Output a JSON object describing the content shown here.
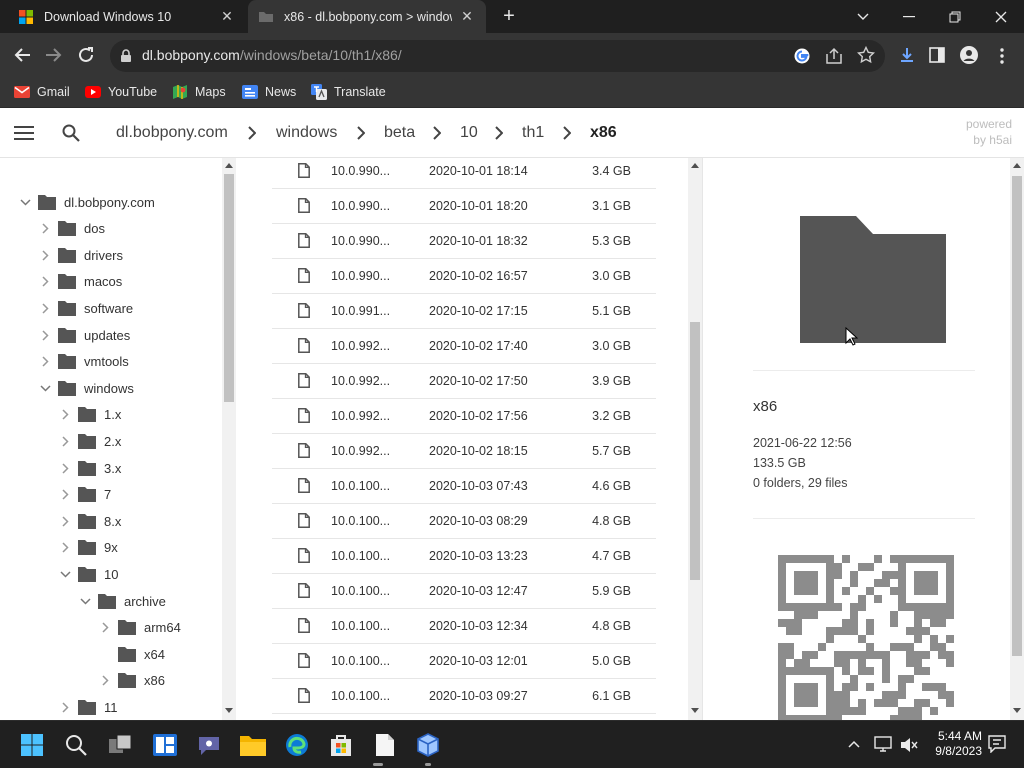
{
  "tabs": [
    {
      "title": "Download Windows 10",
      "active": false
    },
    {
      "title": "x86 - dl.bobpony.com > windows",
      "active": true
    }
  ],
  "toolbar": {
    "url_host": "dl.bobpony.com",
    "url_path": "/windows/beta/10/th1/x86/"
  },
  "bookmarks": [
    {
      "label": "Gmail",
      "icon": "gmail-icon"
    },
    {
      "label": "YouTube",
      "icon": "youtube-icon"
    },
    {
      "label": "Maps",
      "icon": "maps-icon"
    },
    {
      "label": "News",
      "icon": "news-icon"
    },
    {
      "label": "Translate",
      "icon": "translate-icon"
    }
  ],
  "breadcrumb": [
    "dl.bobpony.com",
    "windows",
    "beta",
    "10",
    "th1",
    "x86"
  ],
  "powered": {
    "line1": "powered",
    "line2": "by h5ai"
  },
  "tree": [
    {
      "label": "dl.bobpony.com",
      "depth": 0,
      "expanded": true,
      "chevron": true
    },
    {
      "label": "dos",
      "depth": 1,
      "expanded": false,
      "chevron": true
    },
    {
      "label": "drivers",
      "depth": 1,
      "expanded": false,
      "chevron": true
    },
    {
      "label": "macos",
      "depth": 1,
      "expanded": false,
      "chevron": true
    },
    {
      "label": "software",
      "depth": 1,
      "expanded": false,
      "chevron": true
    },
    {
      "label": "updates",
      "depth": 1,
      "expanded": false,
      "chevron": true
    },
    {
      "label": "vmtools",
      "depth": 1,
      "expanded": false,
      "chevron": true
    },
    {
      "label": "windows",
      "depth": 1,
      "expanded": true,
      "chevron": true
    },
    {
      "label": "1.x",
      "depth": 2,
      "expanded": false,
      "chevron": true
    },
    {
      "label": "2.x",
      "depth": 2,
      "expanded": false,
      "chevron": true
    },
    {
      "label": "3.x",
      "depth": 2,
      "expanded": false,
      "chevron": true
    },
    {
      "label": "7",
      "depth": 2,
      "expanded": false,
      "chevron": true
    },
    {
      "label": "8.x",
      "depth": 2,
      "expanded": false,
      "chevron": true
    },
    {
      "label": "9x",
      "depth": 2,
      "expanded": false,
      "chevron": true
    },
    {
      "label": "10",
      "depth": 2,
      "expanded": true,
      "chevron": true
    },
    {
      "label": "archive",
      "depth": 3,
      "expanded": true,
      "chevron": true
    },
    {
      "label": "arm64",
      "depth": 4,
      "expanded": false,
      "chevron": true
    },
    {
      "label": "x64",
      "depth": 4,
      "expanded": false,
      "chevron": false
    },
    {
      "label": "x86",
      "depth": 4,
      "expanded": false,
      "chevron": true
    },
    {
      "label": "11",
      "depth": 2,
      "expanded": false,
      "chevron": true
    }
  ],
  "files": [
    {
      "name": "10.0.990...",
      "date": "2020-10-01 18:14",
      "size": "3.4 GB"
    },
    {
      "name": "10.0.990...",
      "date": "2020-10-01 18:20",
      "size": "3.1 GB"
    },
    {
      "name": "10.0.990...",
      "date": "2020-10-01 18:32",
      "size": "5.3 GB"
    },
    {
      "name": "10.0.990...",
      "date": "2020-10-02 16:57",
      "size": "3.0 GB"
    },
    {
      "name": "10.0.991...",
      "date": "2020-10-02 17:15",
      "size": "5.1 GB"
    },
    {
      "name": "10.0.992...",
      "date": "2020-10-02 17:40",
      "size": "3.0 GB"
    },
    {
      "name": "10.0.992...",
      "date": "2020-10-02 17:50",
      "size": "3.9 GB"
    },
    {
      "name": "10.0.992...",
      "date": "2020-10-02 17:56",
      "size": "3.2 GB"
    },
    {
      "name": "10.0.992...",
      "date": "2020-10-02 18:15",
      "size": "5.7 GB"
    },
    {
      "name": "10.0.100...",
      "date": "2020-10-03 07:43",
      "size": "4.6 GB"
    },
    {
      "name": "10.0.100...",
      "date": "2020-10-03 08:29",
      "size": "4.8 GB"
    },
    {
      "name": "10.0.100...",
      "date": "2020-10-03 13:23",
      "size": "4.7 GB"
    },
    {
      "name": "10.0.100...",
      "date": "2020-10-03 12:47",
      "size": "5.9 GB"
    },
    {
      "name": "10.0.100...",
      "date": "2020-10-03 12:34",
      "size": "4.8 GB"
    },
    {
      "name": "10.0.100...",
      "date": "2020-10-03 12:01",
      "size": "5.0 GB"
    },
    {
      "name": "10.0.100...",
      "date": "2020-10-03 09:27",
      "size": "6.1 GB"
    }
  ],
  "info": {
    "name": "x86",
    "date": "2021-06-22 12:56",
    "size": "133.5 GB",
    "counts": "0 folders, 29 files"
  },
  "taskbar": {
    "time": "5:44 AM",
    "date": "9/8/2023"
  },
  "colors": {
    "folder": "#555555",
    "chrome_bg": "#353535",
    "tabstrip_bg": "#1f1f1f",
    "taskbar_bg": "#202020"
  }
}
